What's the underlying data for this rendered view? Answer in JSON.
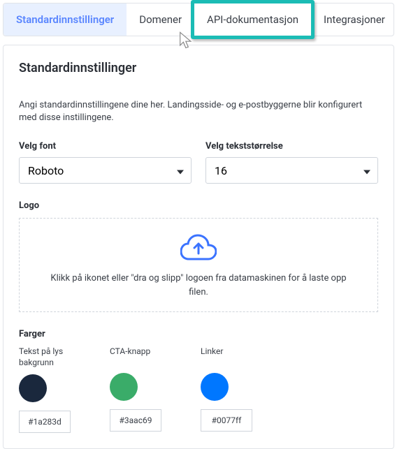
{
  "tabs": {
    "standard": "Standardinnstillinger",
    "domener": "Domener",
    "api": "API-dokumentasjon",
    "integrasjoner": "Integrasjoner"
  },
  "panel": {
    "title": "Standardinnstillinger",
    "description": "Angi standardinnstillingene dine her. Landingsside- og e-postbyggerne blir konfigurert med disse instillingene."
  },
  "font": {
    "label": "Velg font",
    "value": "Roboto"
  },
  "size": {
    "label": "Velg tekststørrelse",
    "value": "16"
  },
  "logo": {
    "label": "Logo",
    "instruction": "Klikk på ikonet eller \"dra og slipp\" logoen fra datamaskinen for å laste opp filen."
  },
  "colors": {
    "label": "Farger",
    "items": [
      {
        "label": "Tekst på lys bakgrunn",
        "hex": "#1a283d"
      },
      {
        "label": "CTA-knapp",
        "hex": "#3aac69"
      },
      {
        "label": "Linker",
        "hex": "#0077ff"
      }
    ]
  }
}
